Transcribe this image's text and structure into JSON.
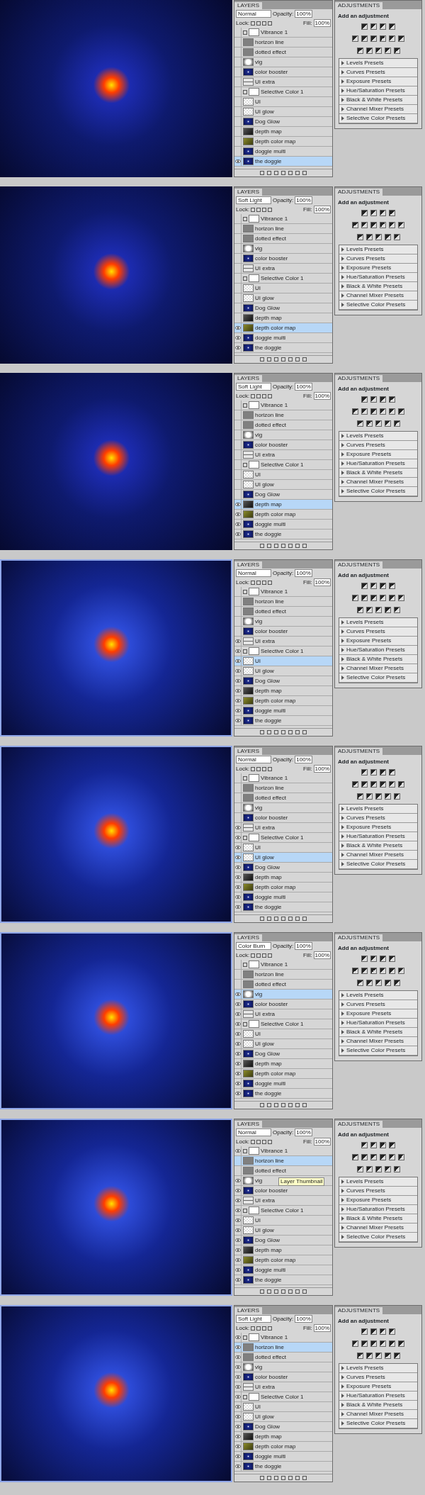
{
  "screens": [
    {
      "layers_tab": "LAYERS",
      "blend_mode": "Normal",
      "opacity_label": "Opacity:",
      "opacity": "100%",
      "lock_label": "Lock:",
      "fill_label": "Fill:",
      "fill": "100%",
      "layers": [
        {
          "name": "Vibrance 1",
          "kind": "adjustment",
          "visible": false,
          "selected": false
        },
        {
          "name": "horizon line",
          "kind": "gray",
          "visible": false,
          "selected": false
        },
        {
          "name": "dotted effect",
          "kind": "gray",
          "visible": false,
          "selected": false
        },
        {
          "name": "vig",
          "kind": "vig",
          "visible": false,
          "selected": false
        },
        {
          "name": "color booster",
          "kind": "dark",
          "visible": false,
          "selected": false
        },
        {
          "name": "UI extra",
          "kind": "line",
          "visible": false,
          "selected": false
        },
        {
          "name": "Selective Color 1",
          "kind": "adjustment",
          "visible": false,
          "selected": false
        },
        {
          "name": "UI",
          "kind": "checker",
          "visible": false,
          "selected": false
        },
        {
          "name": "UI glow",
          "kind": "checker",
          "visible": false,
          "selected": false
        },
        {
          "name": "Dog Glow",
          "kind": "dark",
          "visible": false,
          "selected": false
        },
        {
          "name": "depth map",
          "kind": "depth",
          "visible": false,
          "selected": false
        },
        {
          "name": "depth color map",
          "kind": "olive",
          "visible": false,
          "selected": false
        },
        {
          "name": "doggie multi",
          "kind": "dark",
          "visible": false,
          "selected": false
        },
        {
          "name": "the doggie",
          "kind": "dark",
          "visible": true,
          "selected": true
        }
      ],
      "adjustments": {
        "tab": "ADJUSTMENTS",
        "heading": "Add an adjustment",
        "presets": [
          "Levels Presets",
          "Curves Presets",
          "Exposure Presets",
          "Hue/Saturation Presets",
          "Black & White Presets",
          "Channel Mixer Presets",
          "Selective Color Presets"
        ]
      }
    },
    {
      "layers_tab": "LAYERS",
      "blend_mode": "Soft Light",
      "opacity_label": "Opacity:",
      "opacity": "100%",
      "lock_label": "Lock:",
      "fill_label": "Fill:",
      "fill": "100%",
      "layers": [
        {
          "name": "Vibrance 1",
          "kind": "adjustment",
          "visible": false,
          "selected": false
        },
        {
          "name": "horizon line",
          "kind": "gray",
          "visible": false,
          "selected": false
        },
        {
          "name": "dotted effect",
          "kind": "gray",
          "visible": false,
          "selected": false
        },
        {
          "name": "vig",
          "kind": "vig",
          "visible": false,
          "selected": false
        },
        {
          "name": "color booster",
          "kind": "dark",
          "visible": false,
          "selected": false
        },
        {
          "name": "UI extra",
          "kind": "line",
          "visible": false,
          "selected": false
        },
        {
          "name": "Selective Color 1",
          "kind": "adjustment",
          "visible": false,
          "selected": false
        },
        {
          "name": "UI",
          "kind": "checker",
          "visible": false,
          "selected": false
        },
        {
          "name": "UI glow",
          "kind": "checker",
          "visible": false,
          "selected": false
        },
        {
          "name": "Dog Glow",
          "kind": "dark",
          "visible": false,
          "selected": false
        },
        {
          "name": "depth map",
          "kind": "depth",
          "visible": false,
          "selected": false
        },
        {
          "name": "depth color map",
          "kind": "olive",
          "visible": true,
          "selected": true
        },
        {
          "name": "doggie multi",
          "kind": "dark",
          "visible": true,
          "selected": false
        },
        {
          "name": "the doggie",
          "kind": "dark",
          "visible": true,
          "selected": false
        }
      ],
      "adjustments": {
        "tab": "ADJUSTMENTS",
        "heading": "Add an adjustment",
        "presets": [
          "Levels Presets",
          "Curves Presets",
          "Exposure Presets",
          "Hue/Saturation Presets",
          "Black & White Presets",
          "Channel Mixer Presets",
          "Selective Color Presets"
        ]
      }
    },
    {
      "layers_tab": "LAYERS",
      "blend_mode": "Soft Light",
      "opacity_label": "Opacity:",
      "opacity": "100%",
      "lock_label": "Lock:",
      "fill_label": "Fill:",
      "fill": "100%",
      "layers": [
        {
          "name": "Vibrance 1",
          "kind": "adjustment",
          "visible": false,
          "selected": false
        },
        {
          "name": "horizon line",
          "kind": "gray",
          "visible": false,
          "selected": false
        },
        {
          "name": "dotted effect",
          "kind": "gray",
          "visible": false,
          "selected": false
        },
        {
          "name": "vig",
          "kind": "vig",
          "visible": false,
          "selected": false
        },
        {
          "name": "color booster",
          "kind": "dark",
          "visible": false,
          "selected": false
        },
        {
          "name": "UI extra",
          "kind": "line",
          "visible": false,
          "selected": false
        },
        {
          "name": "Selective Color 1",
          "kind": "adjustment",
          "visible": false,
          "selected": false
        },
        {
          "name": "UI",
          "kind": "checker",
          "visible": false,
          "selected": false
        },
        {
          "name": "UI glow",
          "kind": "checker",
          "visible": false,
          "selected": false
        },
        {
          "name": "Dog Glow",
          "kind": "dark",
          "visible": false,
          "selected": false
        },
        {
          "name": "depth map",
          "kind": "depth",
          "visible": true,
          "selected": true
        },
        {
          "name": "depth color map",
          "kind": "olive",
          "visible": true,
          "selected": false
        },
        {
          "name": "doggie multi",
          "kind": "dark",
          "visible": true,
          "selected": false
        },
        {
          "name": "the doggie",
          "kind": "dark",
          "visible": true,
          "selected": false
        }
      ],
      "adjustments": {
        "tab": "ADJUSTMENTS",
        "heading": "Add an adjustment",
        "presets": [
          "Levels Presets",
          "Curves Presets",
          "Exposure Presets",
          "Hue/Saturation Presets",
          "Black & White Presets",
          "Channel Mixer Presets",
          "Selective Color Presets"
        ]
      }
    },
    {
      "layers_tab": "LAYERS",
      "blend_mode": "Normal",
      "opacity_label": "Opacity:",
      "opacity": "100%",
      "lock_label": "Lock:",
      "fill_label": "Fill:",
      "fill": "100%",
      "layers": [
        {
          "name": "Vibrance 1",
          "kind": "adjustment",
          "visible": false,
          "selected": false
        },
        {
          "name": "horizon line",
          "kind": "gray",
          "visible": false,
          "selected": false
        },
        {
          "name": "dotted effect",
          "kind": "gray",
          "visible": false,
          "selected": false
        },
        {
          "name": "vig",
          "kind": "vig",
          "visible": false,
          "selected": false
        },
        {
          "name": "color booster",
          "kind": "dark",
          "visible": false,
          "selected": false
        },
        {
          "name": "UI extra",
          "kind": "line",
          "visible": true,
          "selected": false
        },
        {
          "name": "Selective Color 1",
          "kind": "adjustment",
          "visible": true,
          "selected": false
        },
        {
          "name": "UI",
          "kind": "checker",
          "visible": true,
          "selected": true
        },
        {
          "name": "UI glow",
          "kind": "checker",
          "visible": true,
          "selected": false
        },
        {
          "name": "Dog Glow",
          "kind": "dark",
          "visible": true,
          "selected": false
        },
        {
          "name": "depth map",
          "kind": "depth",
          "visible": true,
          "selected": false
        },
        {
          "name": "depth color map",
          "kind": "olive",
          "visible": true,
          "selected": false
        },
        {
          "name": "doggie multi",
          "kind": "dark",
          "visible": true,
          "selected": false
        },
        {
          "name": "the doggie",
          "kind": "dark",
          "visible": true,
          "selected": false
        }
      ],
      "adjustments": {
        "tab": "ADJUSTMENTS",
        "heading": "Add an adjustment",
        "presets": [
          "Levels Presets",
          "Curves Presets",
          "Exposure Presets",
          "Hue/Saturation Presets",
          "Black & White Presets",
          "Channel Mixer Presets",
          "Selective Color Presets"
        ]
      }
    },
    {
      "layers_tab": "LAYERS",
      "blend_mode": "Normal",
      "opacity_label": "Opacity:",
      "opacity": "100%",
      "lock_label": "Lock:",
      "fill_label": "Fill:",
      "fill": "100%",
      "layers": [
        {
          "name": "Vibrance 1",
          "kind": "adjustment",
          "visible": false,
          "selected": false
        },
        {
          "name": "horizon line",
          "kind": "gray",
          "visible": false,
          "selected": false
        },
        {
          "name": "dotted effect",
          "kind": "gray",
          "visible": false,
          "selected": false
        },
        {
          "name": "vig",
          "kind": "vig",
          "visible": false,
          "selected": false
        },
        {
          "name": "color booster",
          "kind": "dark",
          "visible": false,
          "selected": false
        },
        {
          "name": "UI extra",
          "kind": "line",
          "visible": true,
          "selected": false
        },
        {
          "name": "Selective Color 1",
          "kind": "adjustment",
          "visible": true,
          "selected": false
        },
        {
          "name": "UI",
          "kind": "checker",
          "visible": true,
          "selected": false
        },
        {
          "name": "UI glow",
          "kind": "checker",
          "visible": true,
          "selected": true
        },
        {
          "name": "Dog Glow",
          "kind": "dark",
          "visible": true,
          "selected": false
        },
        {
          "name": "depth map",
          "kind": "depth",
          "visible": true,
          "selected": false
        },
        {
          "name": "depth color map",
          "kind": "olive",
          "visible": true,
          "selected": false
        },
        {
          "name": "doggie multi",
          "kind": "dark",
          "visible": true,
          "selected": false
        },
        {
          "name": "the doggie",
          "kind": "dark",
          "visible": true,
          "selected": false
        }
      ],
      "adjustments": {
        "tab": "ADJUSTMENTS",
        "heading": "Add an adjustment",
        "presets": [
          "Levels Presets",
          "Curves Presets",
          "Exposure Presets",
          "Hue/Saturation Presets",
          "Black & White Presets",
          "Channel Mixer Presets",
          "Selective Color Presets"
        ]
      }
    },
    {
      "layers_tab": "LAYERS",
      "blend_mode": "Color Burn",
      "opacity_label": "Opacity:",
      "opacity": "100%",
      "lock_label": "Lock:",
      "fill_label": "Fill:",
      "fill": "100%",
      "layers": [
        {
          "name": "Vibrance 1",
          "kind": "adjustment",
          "visible": false,
          "selected": false
        },
        {
          "name": "horizon line",
          "kind": "gray",
          "visible": false,
          "selected": false
        },
        {
          "name": "dotted effect",
          "kind": "gray",
          "visible": false,
          "selected": false
        },
        {
          "name": "vig",
          "kind": "vig",
          "visible": true,
          "selected": true
        },
        {
          "name": "color booster",
          "kind": "dark",
          "visible": true,
          "selected": false
        },
        {
          "name": "UI extra",
          "kind": "line",
          "visible": true,
          "selected": false
        },
        {
          "name": "Selective Color 1",
          "kind": "adjustment",
          "visible": true,
          "selected": false
        },
        {
          "name": "UI",
          "kind": "checker",
          "visible": true,
          "selected": false
        },
        {
          "name": "UI glow",
          "kind": "checker",
          "visible": true,
          "selected": false
        },
        {
          "name": "Dog Glow",
          "kind": "dark",
          "visible": true,
          "selected": false
        },
        {
          "name": "depth map",
          "kind": "depth",
          "visible": true,
          "selected": false
        },
        {
          "name": "depth color map",
          "kind": "olive",
          "visible": true,
          "selected": false
        },
        {
          "name": "doggie multi",
          "kind": "dark",
          "visible": true,
          "selected": false
        },
        {
          "name": "the doggie",
          "kind": "dark",
          "visible": true,
          "selected": false
        }
      ],
      "adjustments": {
        "tab": "ADJUSTMENTS",
        "heading": "Add an adjustment",
        "presets": [
          "Levels Presets",
          "Curves Presets",
          "Exposure Presets",
          "Hue/Saturation Presets",
          "Black & White Presets",
          "Channel Mixer Presets",
          "Selective Color Presets"
        ]
      }
    },
    {
      "layers_tab": "LAYERS",
      "blend_mode": "Normal",
      "opacity_label": "Opacity:",
      "opacity": "100%",
      "lock_label": "Lock:",
      "fill_label": "Fill:",
      "fill": "100%",
      "tooltip": "Layer Thumbnail",
      "layers": [
        {
          "name": "Vibrance 1",
          "kind": "adjustment",
          "visible": true,
          "selected": false
        },
        {
          "name": "horizon line",
          "kind": "gray",
          "visible": false,
          "selected": true
        },
        {
          "name": "dotted effect",
          "kind": "gray",
          "visible": false,
          "selected": false
        },
        {
          "name": "vig",
          "kind": "vig",
          "visible": true,
          "selected": false
        },
        {
          "name": "color booster",
          "kind": "dark",
          "visible": true,
          "selected": false
        },
        {
          "name": "UI extra",
          "kind": "line",
          "visible": true,
          "selected": false
        },
        {
          "name": "Selective Color 1",
          "kind": "adjustment",
          "visible": true,
          "selected": false
        },
        {
          "name": "UI",
          "kind": "checker",
          "visible": true,
          "selected": false
        },
        {
          "name": "UI glow",
          "kind": "checker",
          "visible": true,
          "selected": false
        },
        {
          "name": "Dog Glow",
          "kind": "dark",
          "visible": true,
          "selected": false
        },
        {
          "name": "depth map",
          "kind": "depth",
          "visible": true,
          "selected": false
        },
        {
          "name": "depth color map",
          "kind": "olive",
          "visible": true,
          "selected": false
        },
        {
          "name": "doggie multi",
          "kind": "dark",
          "visible": true,
          "selected": false
        },
        {
          "name": "the doggie",
          "kind": "dark",
          "visible": true,
          "selected": false
        }
      ],
      "adjustments": {
        "tab": "ADJUSTMENTS",
        "heading": "Add an adjustment",
        "presets": [
          "Levels Presets",
          "Curves Presets",
          "Exposure Presets",
          "Hue/Saturation Presets",
          "Black & White Presets",
          "Channel Mixer Presets",
          "Selective Color Presets"
        ]
      }
    },
    {
      "layers_tab": "LAYERS",
      "blend_mode": "Soft Light",
      "opacity_label": "Opacity:",
      "opacity": "100%",
      "lock_label": "Lock:",
      "fill_label": "Fill:",
      "fill": "100%",
      "layers": [
        {
          "name": "Vibrance 1",
          "kind": "adjustment",
          "visible": true,
          "selected": false
        },
        {
          "name": "horizon line",
          "kind": "gray",
          "visible": true,
          "selected": true
        },
        {
          "name": "dotted effect",
          "kind": "gray",
          "visible": true,
          "selected": false
        },
        {
          "name": "vig",
          "kind": "vig",
          "visible": true,
          "selected": false
        },
        {
          "name": "color booster",
          "kind": "dark",
          "visible": true,
          "selected": false
        },
        {
          "name": "UI extra",
          "kind": "line",
          "visible": true,
          "selected": false
        },
        {
          "name": "Selective Color 1",
          "kind": "adjustment",
          "visible": true,
          "selected": false
        },
        {
          "name": "UI",
          "kind": "checker",
          "visible": true,
          "selected": false
        },
        {
          "name": "UI glow",
          "kind": "checker",
          "visible": true,
          "selected": false
        },
        {
          "name": "Dog Glow",
          "kind": "dark",
          "visible": true,
          "selected": false
        },
        {
          "name": "depth map",
          "kind": "depth",
          "visible": true,
          "selected": false
        },
        {
          "name": "depth color map",
          "kind": "olive",
          "visible": true,
          "selected": false
        },
        {
          "name": "doggie multi",
          "kind": "dark",
          "visible": true,
          "selected": false
        },
        {
          "name": "the doggie",
          "kind": "dark",
          "visible": true,
          "selected": false
        }
      ],
      "adjustments": {
        "tab": "ADJUSTMENTS",
        "heading": "Add an adjustment",
        "presets": [
          "Levels Presets",
          "Curves Presets",
          "Exposure Presets",
          "Hue/Saturation Presets",
          "Black & White Presets",
          "Channel Mixer Presets",
          "Selective Color Presets"
        ]
      }
    }
  ]
}
